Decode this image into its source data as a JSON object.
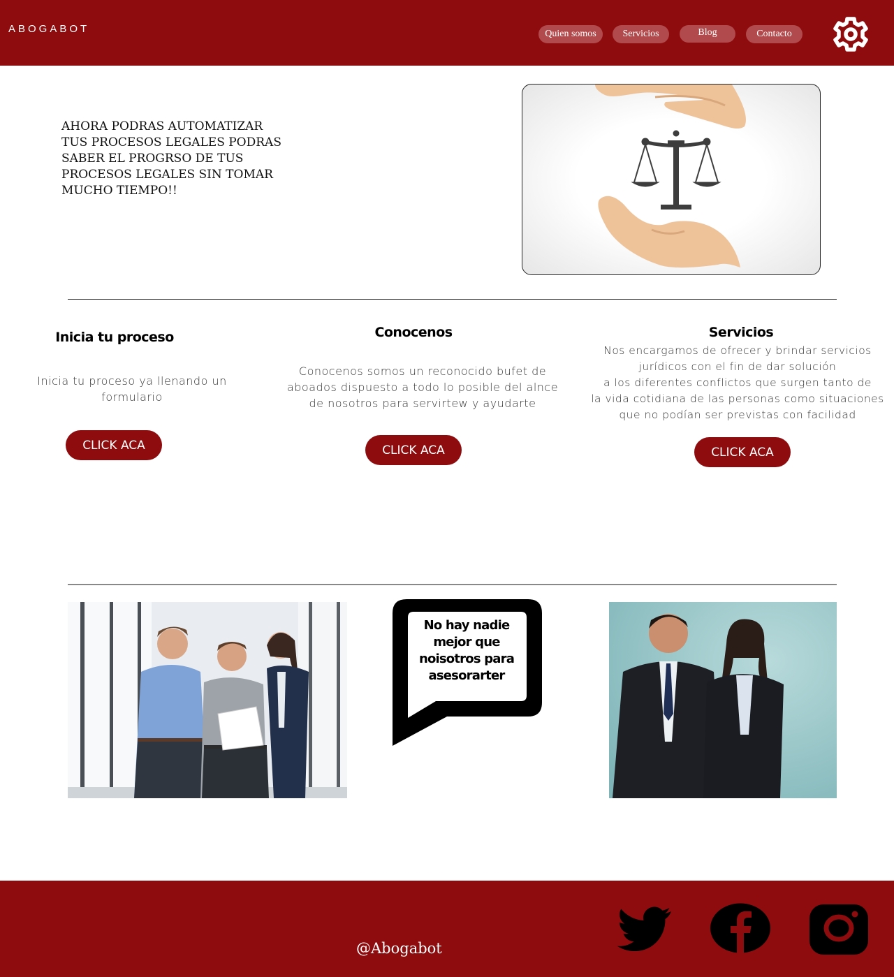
{
  "header": {
    "logo": "ABOGABOT",
    "nav": [
      {
        "label": "Quien somos"
      },
      {
        "label": "Servicios"
      },
      {
        "label": "Blog"
      },
      {
        "label": "Contacto"
      }
    ],
    "settings_icon": "gear-icon"
  },
  "hero": {
    "headline": "AHORA PODRAS AUTOMATIZAR TUS PROCESOS LEGALES PODRAS SABER EL PROGRSO DE TUS PROCESOS LEGALES SIN TOMAR MUCHO TIEMPO!!",
    "image_icon": "justice-scale-hands-icon"
  },
  "columns": [
    {
      "title": "Inicia tu proceso",
      "text": "Inicia tu proceso ya llenando un formulario",
      "button": "CLICK ACA"
    },
    {
      "title": "Conocenos",
      "text": "Conocenos somos un reconocido bufet de aboados dispuesto a todo lo posible del alnce de nosotros para servirtew y ayudarte",
      "button": "CLICK ACA"
    },
    {
      "title": "Servicios",
      "lines": [
        "Nos encargamos de ofrecer y brindar servicios",
        "jurídicos con el fin de dar solución",
        "a los diferentes conflictos que surgen tanto de",
        "la vida cotidiana de las personas como situaciones",
        "que no podían ser previstas con facilidad"
      ],
      "button": "CLICK ACA"
    }
  ],
  "gallery": {
    "bubble_text": "No hay nadie mejor que noisotros para asesorarter"
  },
  "footer": {
    "handle": "@Abogabot",
    "social": [
      "twitter-icon",
      "facebook-icon",
      "instagram-icon"
    ]
  },
  "colors": {
    "brand": "#8e0c0e",
    "pill": "#b14a4c"
  }
}
